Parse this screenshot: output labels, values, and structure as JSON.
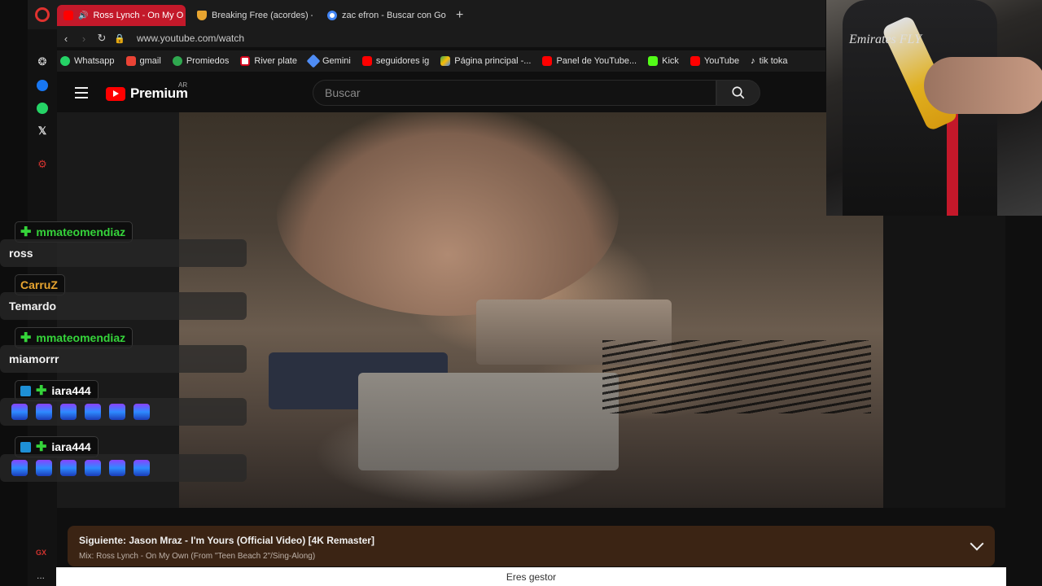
{
  "browser": {
    "tabs": [
      {
        "label": "Ross Lynch - On My O",
        "active": true
      },
      {
        "label": "Breaking Free (acordes) -",
        "active": false
      },
      {
        "label": "zac efron - Buscar con Go",
        "active": false
      }
    ],
    "new_tab": "+",
    "url": "www.youtube.com/watch",
    "bookmarks": [
      "Whatsapp",
      "gmail",
      "Promiedos",
      "River plate",
      "Gemini",
      "seguidores ig",
      "Página principal -...",
      "Panel de YouTube...",
      "Kick",
      "YouTube",
      "tik toka"
    ],
    "bottom_gx": "GX",
    "bottom_dots": "..."
  },
  "youtube": {
    "brand": "Premium",
    "region": "AR",
    "search_placeholder": "Buscar"
  },
  "up_next": {
    "title": "Siguiente: Jason Mraz - I'm Yours (Official Video) [4K Remaster]",
    "subtitle": "Mix: Ross Lynch - On My Own (From \"Teen Beach 2\"/Sing-Along)"
  },
  "status_bar": {
    "text": "Eres gestor"
  },
  "chat": [
    {
      "user": "mmateomendiaz",
      "color": "#35d43a",
      "message": "ross",
      "badge": "plus"
    },
    {
      "user": "CarruZ",
      "color": "#e8a530",
      "message": "Temardo",
      "badge": "none"
    },
    {
      "user": "mmateomendiaz",
      "color": "#35d43a",
      "message": "miamorrr",
      "badge": "plus"
    },
    {
      "user": "iara444",
      "color": "#ffffff",
      "message": "",
      "badge": "sub-plus",
      "emotes": 6
    },
    {
      "user": "iara444",
      "color": "#ffffff",
      "message": "",
      "badge": "sub-plus",
      "emotes": 6
    }
  ],
  "webcam": {
    "shirt_text": "Emirates FLY"
  },
  "colors": {
    "opera_red": "#c3192a",
    "yt_red": "#ff0000",
    "upnext_bg": "#3b2414"
  }
}
